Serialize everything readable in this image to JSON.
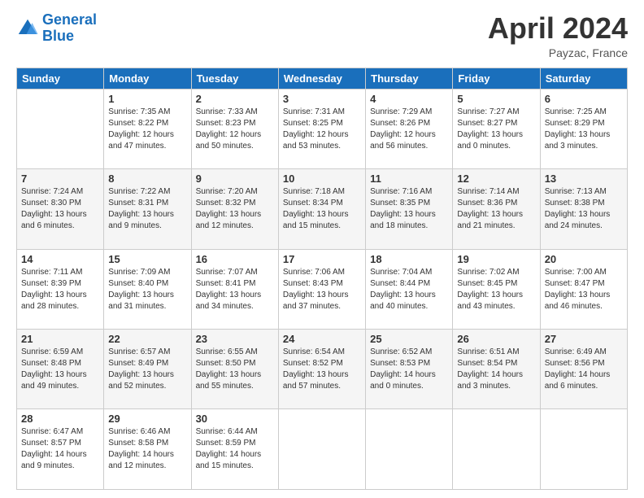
{
  "header": {
    "logo_line1": "General",
    "logo_line2": "Blue",
    "month": "April 2024",
    "location": "Payzac, France"
  },
  "columns": [
    "Sunday",
    "Monday",
    "Tuesday",
    "Wednesday",
    "Thursday",
    "Friday",
    "Saturday"
  ],
  "weeks": [
    [
      {
        "day": "",
        "info": ""
      },
      {
        "day": "1",
        "info": "Sunrise: 7:35 AM\nSunset: 8:22 PM\nDaylight: 12 hours\nand 47 minutes."
      },
      {
        "day": "2",
        "info": "Sunrise: 7:33 AM\nSunset: 8:23 PM\nDaylight: 12 hours\nand 50 minutes."
      },
      {
        "day": "3",
        "info": "Sunrise: 7:31 AM\nSunset: 8:25 PM\nDaylight: 12 hours\nand 53 minutes."
      },
      {
        "day": "4",
        "info": "Sunrise: 7:29 AM\nSunset: 8:26 PM\nDaylight: 12 hours\nand 56 minutes."
      },
      {
        "day": "5",
        "info": "Sunrise: 7:27 AM\nSunset: 8:27 PM\nDaylight: 13 hours\nand 0 minutes."
      },
      {
        "day": "6",
        "info": "Sunrise: 7:25 AM\nSunset: 8:29 PM\nDaylight: 13 hours\nand 3 minutes."
      }
    ],
    [
      {
        "day": "7",
        "info": "Sunrise: 7:24 AM\nSunset: 8:30 PM\nDaylight: 13 hours\nand 6 minutes."
      },
      {
        "day": "8",
        "info": "Sunrise: 7:22 AM\nSunset: 8:31 PM\nDaylight: 13 hours\nand 9 minutes."
      },
      {
        "day": "9",
        "info": "Sunrise: 7:20 AM\nSunset: 8:32 PM\nDaylight: 13 hours\nand 12 minutes."
      },
      {
        "day": "10",
        "info": "Sunrise: 7:18 AM\nSunset: 8:34 PM\nDaylight: 13 hours\nand 15 minutes."
      },
      {
        "day": "11",
        "info": "Sunrise: 7:16 AM\nSunset: 8:35 PM\nDaylight: 13 hours\nand 18 minutes."
      },
      {
        "day": "12",
        "info": "Sunrise: 7:14 AM\nSunset: 8:36 PM\nDaylight: 13 hours\nand 21 minutes."
      },
      {
        "day": "13",
        "info": "Sunrise: 7:13 AM\nSunset: 8:38 PM\nDaylight: 13 hours\nand 24 minutes."
      }
    ],
    [
      {
        "day": "14",
        "info": "Sunrise: 7:11 AM\nSunset: 8:39 PM\nDaylight: 13 hours\nand 28 minutes."
      },
      {
        "day": "15",
        "info": "Sunrise: 7:09 AM\nSunset: 8:40 PM\nDaylight: 13 hours\nand 31 minutes."
      },
      {
        "day": "16",
        "info": "Sunrise: 7:07 AM\nSunset: 8:41 PM\nDaylight: 13 hours\nand 34 minutes."
      },
      {
        "day": "17",
        "info": "Sunrise: 7:06 AM\nSunset: 8:43 PM\nDaylight: 13 hours\nand 37 minutes."
      },
      {
        "day": "18",
        "info": "Sunrise: 7:04 AM\nSunset: 8:44 PM\nDaylight: 13 hours\nand 40 minutes."
      },
      {
        "day": "19",
        "info": "Sunrise: 7:02 AM\nSunset: 8:45 PM\nDaylight: 13 hours\nand 43 minutes."
      },
      {
        "day": "20",
        "info": "Sunrise: 7:00 AM\nSunset: 8:47 PM\nDaylight: 13 hours\nand 46 minutes."
      }
    ],
    [
      {
        "day": "21",
        "info": "Sunrise: 6:59 AM\nSunset: 8:48 PM\nDaylight: 13 hours\nand 49 minutes."
      },
      {
        "day": "22",
        "info": "Sunrise: 6:57 AM\nSunset: 8:49 PM\nDaylight: 13 hours\nand 52 minutes."
      },
      {
        "day": "23",
        "info": "Sunrise: 6:55 AM\nSunset: 8:50 PM\nDaylight: 13 hours\nand 55 minutes."
      },
      {
        "day": "24",
        "info": "Sunrise: 6:54 AM\nSunset: 8:52 PM\nDaylight: 13 hours\nand 57 minutes."
      },
      {
        "day": "25",
        "info": "Sunrise: 6:52 AM\nSunset: 8:53 PM\nDaylight: 14 hours\nand 0 minutes."
      },
      {
        "day": "26",
        "info": "Sunrise: 6:51 AM\nSunset: 8:54 PM\nDaylight: 14 hours\nand 3 minutes."
      },
      {
        "day": "27",
        "info": "Sunrise: 6:49 AM\nSunset: 8:56 PM\nDaylight: 14 hours\nand 6 minutes."
      }
    ],
    [
      {
        "day": "28",
        "info": "Sunrise: 6:47 AM\nSunset: 8:57 PM\nDaylight: 14 hours\nand 9 minutes."
      },
      {
        "day": "29",
        "info": "Sunrise: 6:46 AM\nSunset: 8:58 PM\nDaylight: 14 hours\nand 12 minutes."
      },
      {
        "day": "30",
        "info": "Sunrise: 6:44 AM\nSunset: 8:59 PM\nDaylight: 14 hours\nand 15 minutes."
      },
      {
        "day": "",
        "info": ""
      },
      {
        "day": "",
        "info": ""
      },
      {
        "day": "",
        "info": ""
      },
      {
        "day": "",
        "info": ""
      }
    ]
  ]
}
